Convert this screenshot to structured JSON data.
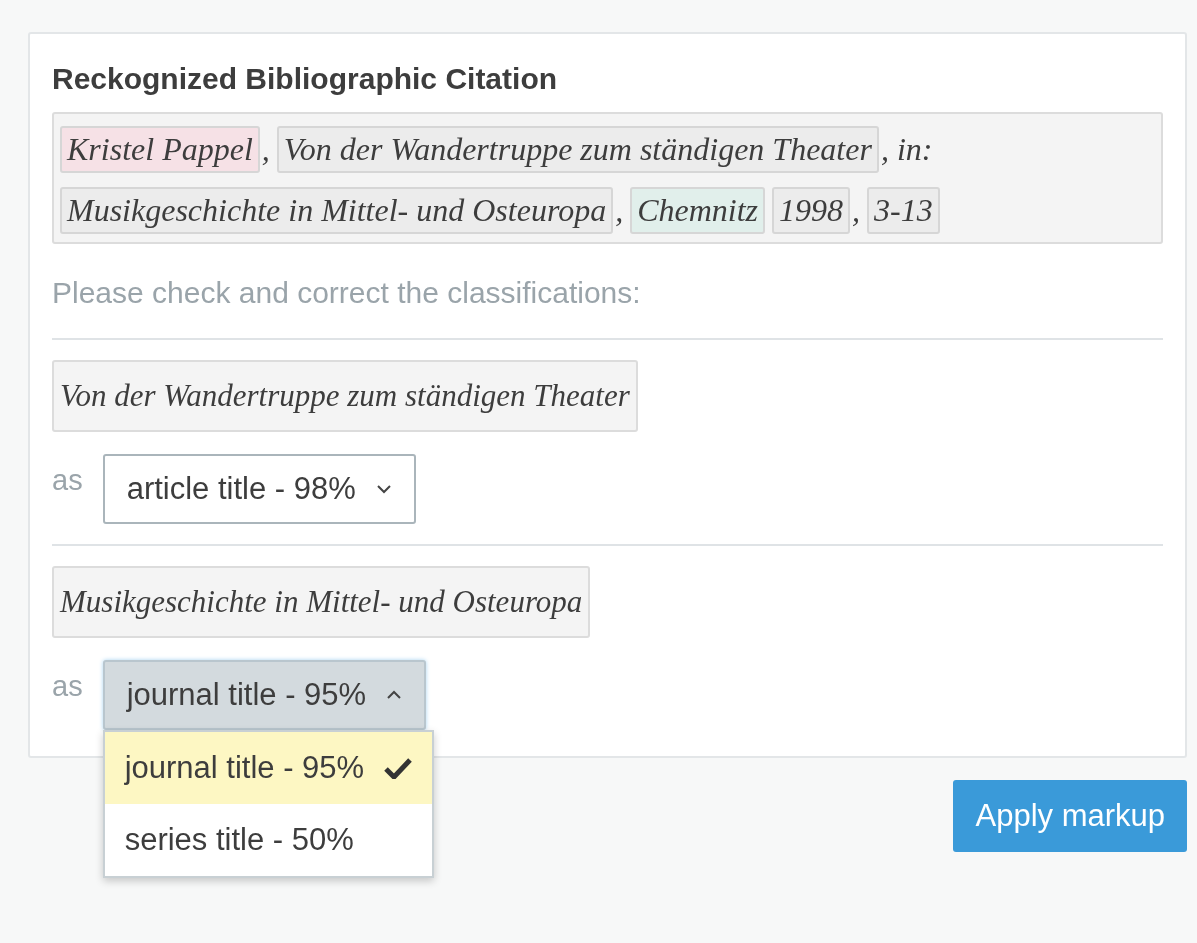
{
  "title": "Reckognized Bibliographic Citation",
  "citation_lines": [
    [
      {
        "kind": "token",
        "text": "Kristel Pappel",
        "color": "#f6e1e6"
      },
      {
        "kind": "sep",
        "text": ","
      },
      {
        "kind": "token",
        "text": "Von der Wandertruppe zum ständigen Theater",
        "color": "#ececec"
      },
      {
        "kind": "sep",
        "text": ", in:"
      }
    ],
    [
      {
        "kind": "token",
        "text": "Musikgeschichte in Mittel- und Osteuropa",
        "color": "#ececec"
      },
      {
        "kind": "sep",
        "text": ","
      },
      {
        "kind": "token",
        "text": "Chemnitz",
        "color": "#e1efeb"
      },
      {
        "kind": "token",
        "text": "1998",
        "color": "#ececec"
      },
      {
        "kind": "sep",
        "text": ","
      },
      {
        "kind": "token",
        "text": "3-13",
        "color": "#ececec"
      }
    ]
  ],
  "instruction": "Please check and correct the classifications:",
  "classifications": [
    {
      "text": "Von der Wandertruppe zum ständigen Theater",
      "as_label": "as",
      "value": "article title - 98%",
      "expanded": false
    },
    {
      "text": "Musikgeschichte in Mittel- und Osteuropa",
      "as_label": "as",
      "value": "journal title - 95%",
      "expanded": true,
      "options": [
        {
          "label": "journal title - 95%",
          "selected": true
        },
        {
          "label": "series title - 50%",
          "selected": false
        }
      ]
    }
  ],
  "apply_button": "Apply markup"
}
